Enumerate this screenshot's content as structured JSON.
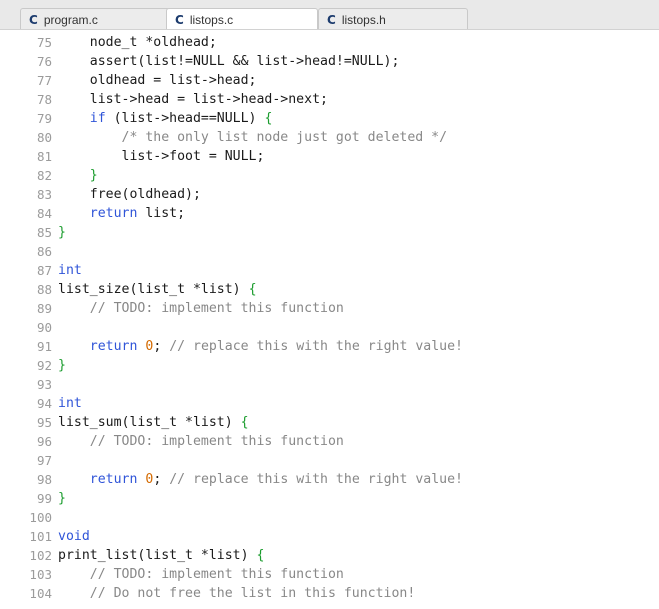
{
  "tabs": [
    {
      "label": "program.c",
      "icon": "c-file-icon",
      "icon_glyph": "C",
      "active": false
    },
    {
      "label": "listops.c",
      "icon": "c-file-icon",
      "icon_glyph": "C",
      "active": true
    },
    {
      "label": "listops.h",
      "icon": "c-file-icon",
      "icon_glyph": "C",
      "active": false
    }
  ],
  "colors": {
    "keyword": "#3055d8",
    "number": "#d46a00",
    "comment": "#888888",
    "brace": "#1a9c2d",
    "line_number": "#9b9b9b"
  },
  "lines": [
    {
      "n": "75",
      "tokens": [
        [
          "tx",
          "    node_t *oldhead;"
        ]
      ]
    },
    {
      "n": "76",
      "tokens": [
        [
          "tx",
          "    assert(list!=NULL && list->head!=NULL);"
        ]
      ]
    },
    {
      "n": "77",
      "tokens": [
        [
          "tx",
          "    oldhead = list->head;"
        ]
      ]
    },
    {
      "n": "78",
      "tokens": [
        [
          "tx",
          "    list->head = list->head->next;"
        ]
      ]
    },
    {
      "n": "79",
      "tokens": [
        [
          "kw",
          "    if"
        ],
        [
          "tx",
          " (list->head==NULL) "
        ],
        [
          "br",
          "{"
        ]
      ]
    },
    {
      "n": "80",
      "tokens": [
        [
          "cm",
          "        /* the only list node just got deleted */"
        ]
      ]
    },
    {
      "n": "81",
      "tokens": [
        [
          "tx",
          "        list->foot = NULL;"
        ]
      ]
    },
    {
      "n": "82",
      "tokens": [
        [
          "br",
          "    }"
        ]
      ]
    },
    {
      "n": "83",
      "tokens": [
        [
          "tx",
          "    free(oldhead);"
        ]
      ]
    },
    {
      "n": "84",
      "tokens": [
        [
          "kw",
          "    return"
        ],
        [
          "tx",
          " list;"
        ]
      ]
    },
    {
      "n": "85",
      "tokens": [
        [
          "br",
          "}"
        ]
      ]
    },
    {
      "n": "86",
      "tokens": []
    },
    {
      "n": "87",
      "tokens": [
        [
          "kw",
          "int"
        ]
      ]
    },
    {
      "n": "88",
      "tokens": [
        [
          "tx",
          "list_size(list_t *list) "
        ],
        [
          "br",
          "{"
        ]
      ]
    },
    {
      "n": "89",
      "tokens": [
        [
          "cm",
          "    // TODO: implement this function"
        ]
      ]
    },
    {
      "n": "90",
      "tokens": []
    },
    {
      "n": "91",
      "tokens": [
        [
          "kw",
          "    return"
        ],
        [
          "tx",
          " "
        ],
        [
          "num",
          "0"
        ],
        [
          "tx",
          "; "
        ],
        [
          "cm",
          "// replace this with the right value!"
        ]
      ]
    },
    {
      "n": "92",
      "tokens": [
        [
          "br",
          "}"
        ]
      ]
    },
    {
      "n": "93",
      "tokens": []
    },
    {
      "n": "94",
      "tokens": [
        [
          "kw",
          "int"
        ]
      ]
    },
    {
      "n": "95",
      "tokens": [
        [
          "tx",
          "list_sum(list_t *list) "
        ],
        [
          "br",
          "{"
        ]
      ]
    },
    {
      "n": "96",
      "tokens": [
        [
          "cm",
          "    // TODO: implement this function"
        ]
      ]
    },
    {
      "n": "97",
      "tokens": []
    },
    {
      "n": "98",
      "tokens": [
        [
          "kw",
          "    return"
        ],
        [
          "tx",
          " "
        ],
        [
          "num",
          "0"
        ],
        [
          "tx",
          "; "
        ],
        [
          "cm",
          "// replace this with the right value!"
        ]
      ]
    },
    {
      "n": "99",
      "tokens": [
        [
          "br",
          "}"
        ]
      ]
    },
    {
      "n": "100",
      "tokens": []
    },
    {
      "n": "101",
      "tokens": [
        [
          "kw",
          "void"
        ]
      ]
    },
    {
      "n": "102",
      "tokens": [
        [
          "tx",
          "print_list(list_t *list) "
        ],
        [
          "br",
          "{"
        ]
      ]
    },
    {
      "n": "103",
      "tokens": [
        [
          "cm",
          "    // TODO: implement this function"
        ]
      ]
    },
    {
      "n": "104",
      "tokens": [
        [
          "cm",
          "    // Do not free the list in this function!"
        ]
      ]
    }
  ]
}
